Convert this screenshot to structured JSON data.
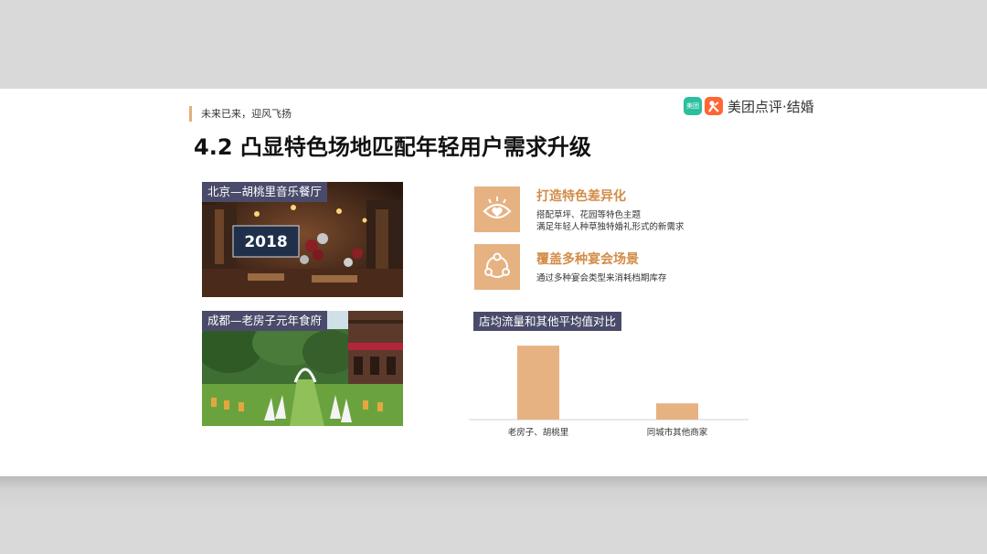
{
  "header": {
    "kicker": "未来已来，迎风飞扬",
    "brand_badge": "美团",
    "brand": "美团点评·结婚",
    "title": "4.2 凸显特色场地匹配年轻用户需求升级"
  },
  "photos": [
    {
      "label": "北京—胡桃里音乐餐厅",
      "sign": "2018"
    },
    {
      "label": "成都—老房子元年食府"
    }
  ],
  "features": [
    {
      "icon": "eye-heart-icon",
      "title": "打造特色差异化",
      "lines": [
        "搭配草坪、花园等特色主题",
        "满足年轻人种草独特婚礼形式的新需求"
      ]
    },
    {
      "icon": "connection-circle-icon",
      "title": "覆盖多种宴会场景",
      "lines": [
        "通过多种宴会类型来消耗档期库存"
      ]
    }
  ],
  "chart_data": {
    "type": "bar",
    "title": "店均流量和其他平均值对比",
    "categories": [
      "老房子、胡桃里",
      "同城市其他商家"
    ],
    "values": [
      100,
      22
    ],
    "color": "#e6b282",
    "ylim": [
      0,
      110
    ],
    "grid": false,
    "legend": "none"
  },
  "colors": {
    "accent": "#e6b282",
    "accent_text": "#d38c47",
    "label_bg": "#4a4b6a"
  }
}
